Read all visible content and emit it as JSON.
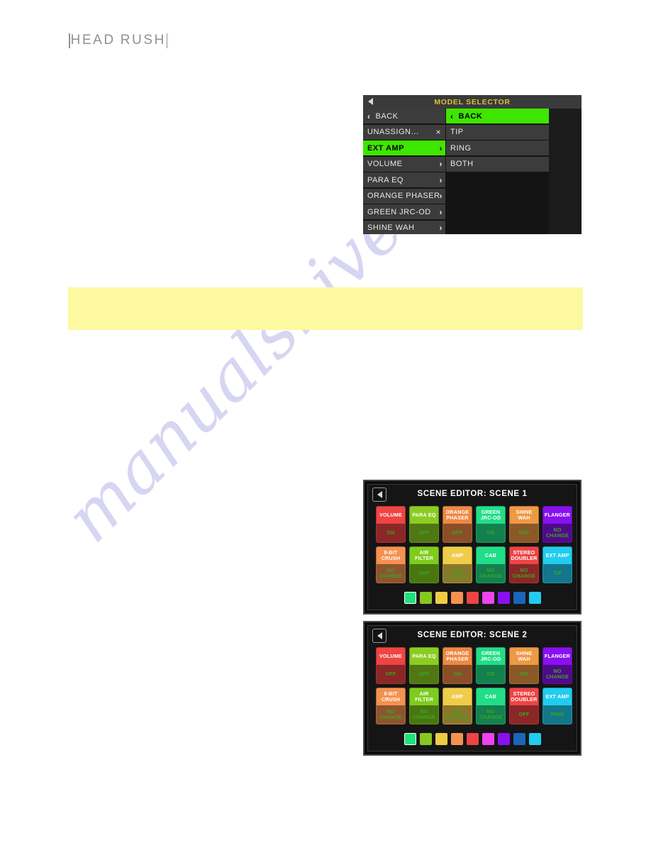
{
  "brand": {
    "name": "HEADRUSH",
    "word1": "HEAD",
    "word2": "RUSH"
  },
  "watermark": {
    "text": "manualshive.com"
  },
  "callout": {
    "text": "",
    "color": "#fcf9a0"
  },
  "model_selector": {
    "title": "MODEL SELECTOR",
    "title_color": "#d8c13c",
    "back_arrow_icon": "back-arrow-icon",
    "left_list": [
      {
        "label": "BACK",
        "type": "back",
        "chevron": "‹",
        "selected": false
      },
      {
        "label": "UNASSIGN…",
        "type": "close",
        "close": "×",
        "selected": false
      },
      {
        "label": "EXT AMP",
        "type": "submenu",
        "chevron": "›",
        "selected": true
      },
      {
        "label": "VOLUME",
        "type": "submenu",
        "chevron": "›",
        "selected": false
      },
      {
        "label": "PARA EQ",
        "type": "submenu",
        "chevron": "›",
        "selected": false
      },
      {
        "label": "ORANGE PHASER",
        "type": "submenu",
        "chevron": "›",
        "selected": false
      },
      {
        "label": "GREEN JRC-OD",
        "type": "submenu",
        "chevron": "›",
        "selected": false
      },
      {
        "label": "SHINE WAH",
        "type": "submenu",
        "chevron": "›",
        "selected": false
      }
    ],
    "right_list": [
      {
        "label": "BACK",
        "type": "back",
        "chevron": "‹",
        "highlighted": true
      },
      {
        "label": "TIP",
        "type": "item",
        "highlighted": false
      },
      {
        "label": "RING",
        "type": "item",
        "highlighted": false
      },
      {
        "label": "BOTH",
        "type": "item",
        "highlighted": false
      }
    ],
    "accent_green": "#3ee600"
  },
  "scene_editors": [
    {
      "id": "scene1",
      "title": "SCENE EDITOR: SCENE 1",
      "back_icon": "back-arrow-icon",
      "tiles": [
        [
          {
            "name": "VOLUME",
            "value": "ON",
            "color": "#ee4444"
          },
          {
            "name": "PARA EQ",
            "value": "OFF",
            "color": "#8ccc22"
          },
          {
            "name": "ORANGE PHASER",
            "value": "OFF",
            "color": "#ee8844"
          },
          {
            "name": "GREEN JRC-OD",
            "value": "ON",
            "color": "#22dd88"
          },
          {
            "name": "SHINE WAH",
            "value": "OFF",
            "color": "#ee9944"
          },
          {
            "name": "FLANGER",
            "value": "NO CHANGE",
            "color": "#8811ee"
          }
        ],
        [
          {
            "name": "8-BIT CRUSH",
            "value": "NO CHANGE",
            "color": "#f59150"
          },
          {
            "name": "AIR FILTER",
            "value": "OFF",
            "color": "#7ecc1e"
          },
          {
            "name": "AMP",
            "value": "NO CHANGE",
            "color": "#f0cc4a"
          },
          {
            "name": "CAB",
            "value": "NO CHANGE",
            "color": "#22dd88"
          },
          {
            "name": "STEREO DOUBLER",
            "value": "NO CHANGE",
            "color": "#ee4444"
          },
          {
            "name": "EXT AMP",
            "value": "TIP",
            "color": "#22ccee"
          }
        ]
      ],
      "swatches": [
        {
          "color": "#1fe07a",
          "selected": true
        },
        {
          "color": "#86c81e",
          "selected": false
        },
        {
          "color": "#eecc44",
          "selected": false
        },
        {
          "color": "#f59150",
          "selected": false
        },
        {
          "color": "#ee4444",
          "selected": false
        },
        {
          "color": "#ee44ee",
          "selected": false
        },
        {
          "color": "#8811ee",
          "selected": false
        },
        {
          "color": "#1a66bb",
          "selected": false
        },
        {
          "color": "#22ccee",
          "selected": false
        }
      ]
    },
    {
      "id": "scene2",
      "title": "SCENE EDITOR: SCENE 2",
      "back_icon": "back-arrow-icon",
      "tiles": [
        [
          {
            "name": "VOLUME",
            "value": "OFF",
            "color": "#ee4444"
          },
          {
            "name": "PARA EQ",
            "value": "OFF",
            "color": "#8ccc22"
          },
          {
            "name": "ORANGE PHASER",
            "value": "ON",
            "color": "#ee8844"
          },
          {
            "name": "GREEN JRC-OD",
            "value": "ON",
            "color": "#22dd88"
          },
          {
            "name": "SHINE WAH",
            "value": "ON",
            "color": "#ee9944"
          },
          {
            "name": "FLANGER",
            "value": "NO CHANGE",
            "color": "#8811ee"
          }
        ],
        [
          {
            "name": "8-BIT CRUSH",
            "value": "NO CHANGE",
            "color": "#f59150"
          },
          {
            "name": "AIR FILTER",
            "value": "NO CHANGE",
            "color": "#7ecc1e"
          },
          {
            "name": "AMP",
            "value": "NO CHANGE",
            "color": "#f0cc4a"
          },
          {
            "name": "CAB",
            "value": "NO CHANGE",
            "color": "#22dd88"
          },
          {
            "name": "STEREO DOUBLER",
            "value": "OFF",
            "color": "#ee4444"
          },
          {
            "name": "EXT AMP",
            "value": "RING",
            "color": "#22ccee"
          }
        ]
      ],
      "swatches": [
        {
          "color": "#1fe07a",
          "selected": true
        },
        {
          "color": "#86c81e",
          "selected": false
        },
        {
          "color": "#eecc44",
          "selected": false
        },
        {
          "color": "#f59150",
          "selected": false
        },
        {
          "color": "#ee4444",
          "selected": false
        },
        {
          "color": "#ee44ee",
          "selected": false
        },
        {
          "color": "#8811ee",
          "selected": false
        },
        {
          "color": "#1a66bb",
          "selected": false
        },
        {
          "color": "#22ccee",
          "selected": false
        }
      ]
    }
  ]
}
